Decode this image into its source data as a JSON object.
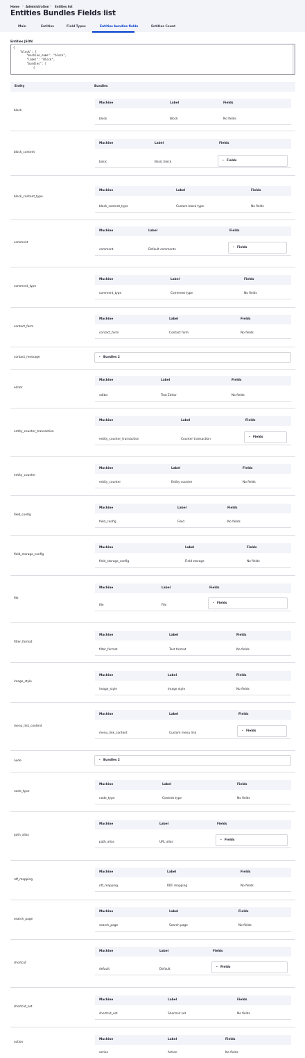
{
  "breadcrumb": {
    "home": "Home",
    "admin": "Administration",
    "current": "Entities list"
  },
  "page_title": "Entities Bundles Fields list",
  "star_glyph": "☆",
  "tabs": [
    {
      "label": "Main",
      "active": false
    },
    {
      "label": "Entities",
      "active": false
    },
    {
      "label": "Field Types",
      "active": false
    },
    {
      "label": "Entities bundles fields",
      "active": true
    },
    {
      "label": "Entities Count",
      "active": false
    }
  ],
  "json_label": "Entities JSON",
  "json_text": "{\n    \"block\": {\n        \"machine_name\": \"block\",\n        \"label\": \"Block\",\n        \"bundles\": [\n            {",
  "table_headers": {
    "entity": "Entity",
    "bundles": "Bundles"
  },
  "inner_headers": {
    "machine": "Machine",
    "label": "Label",
    "fields": "Fields"
  },
  "fields_toggle": "Fields",
  "rows": [
    {
      "entity": "block",
      "machine": "block",
      "label": "Block",
      "fields": "No fields"
    },
    {
      "entity": "block_content",
      "machine": "basic",
      "label": "Basic block",
      "fields": null
    },
    {
      "entity": "block_content_type",
      "machine": "block_content_type",
      "label": "Custom block type",
      "fields": "No fields"
    },
    {
      "entity": "comment",
      "machine": "comment",
      "label": "Default comments",
      "fields": null
    },
    {
      "entity": "comment_type",
      "machine": "comment_type",
      "label": "Comment type",
      "fields": "No fields"
    },
    {
      "entity": "contact_form",
      "machine": "contact_form",
      "label": "Contact form",
      "fields": "No fields"
    },
    {
      "entity": "contact_message",
      "bundles_summary": "Bundles 2"
    },
    {
      "entity": "editor",
      "machine": "editor",
      "label": "Text Editor",
      "fields": "No fields"
    },
    {
      "entity": "entity_counter_transaction",
      "machine": "entity_counter_transaction",
      "label": "Counter transaction",
      "fields": null
    },
    {
      "entity": "entity_counter",
      "machine": "entity_counter",
      "label": "Entity counter",
      "fields": "No fields"
    },
    {
      "entity": "field_config",
      "machine": "field_config",
      "label": "Field",
      "fields": "No fields"
    },
    {
      "entity": "field_storage_config",
      "machine": "field_storage_config",
      "label": "Field storage",
      "fields": "No fields"
    },
    {
      "entity": "file",
      "machine": "file",
      "label": "File",
      "fields": null
    },
    {
      "entity": "filter_format",
      "machine": "filter_format",
      "label": "Text format",
      "fields": "No fields"
    },
    {
      "entity": "image_style",
      "machine": "image_style",
      "label": "Image style",
      "fields": "No fields"
    },
    {
      "entity": "menu_link_content",
      "machine": "menu_link_content",
      "label": "Custom menu link",
      "fields": null
    },
    {
      "entity": "node",
      "bundles_summary": "Bundles 2"
    },
    {
      "entity": "node_type",
      "machine": "node_type",
      "label": "Content type",
      "fields": "No fields"
    },
    {
      "entity": "path_alias",
      "machine": "path_alias",
      "label": "URL alias",
      "fields": null
    },
    {
      "entity": "rdf_mapping",
      "machine": "rdf_mapping",
      "label": "RDF mapping",
      "fields": "No fields"
    },
    {
      "entity": "search_page",
      "machine": "search_page",
      "label": "Search page",
      "fields": "No fields"
    },
    {
      "entity": "shortcut",
      "machine": "default",
      "label": "Default",
      "fields": null
    },
    {
      "entity": "shortcut_set",
      "machine": "shortcut_set",
      "label": "Shortcut set",
      "fields": "No fields"
    },
    {
      "entity": "action",
      "machine": "action",
      "label": "Action",
      "fields": "No fields"
    }
  ]
}
